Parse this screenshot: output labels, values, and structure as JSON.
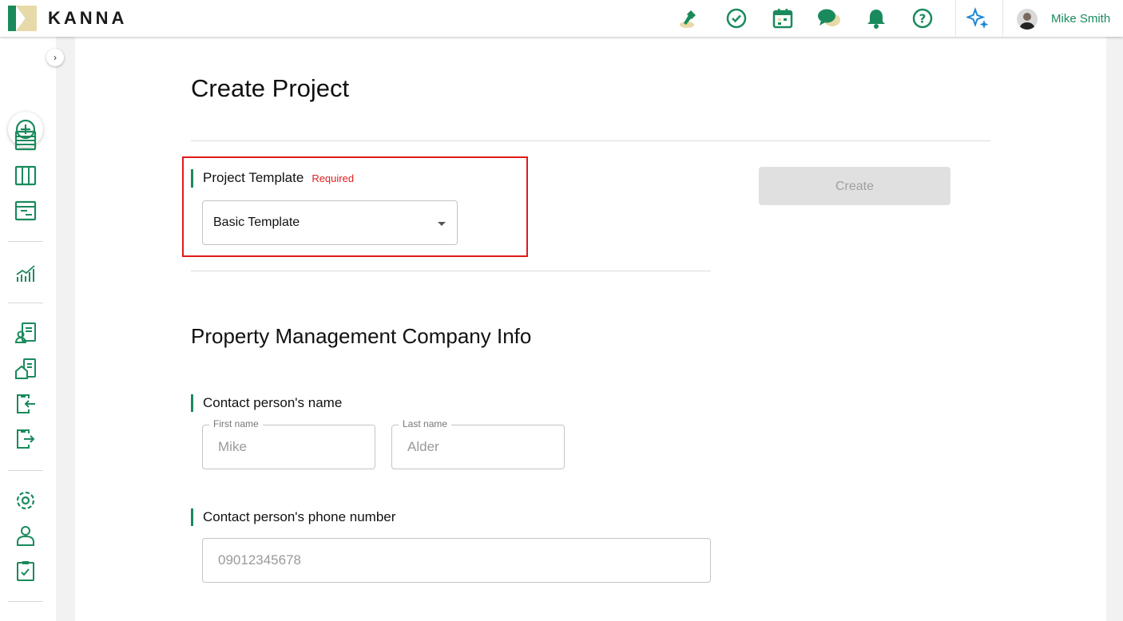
{
  "header": {
    "logo_text": "KANNA",
    "user_name": "Mike Smith",
    "icons": [
      "stamp-icon",
      "check-circle-icon",
      "calendar-icon",
      "chat-icon",
      "bell-icon",
      "help-icon",
      "sparkle-icon"
    ]
  },
  "sidebar": {
    "collapse_glyph": "›",
    "icons": [
      "add-icon",
      "list-icon",
      "board-icon",
      "gantt-icon",
      "analytics-icon",
      "client-icon",
      "property-icon",
      "import-icon",
      "export-icon",
      "settings-icon",
      "user-icon",
      "checklist-icon"
    ]
  },
  "page": {
    "title": "Create Project",
    "create_label": "Create",
    "template": {
      "label": "Project Template",
      "required": "Required",
      "selected": "Basic Template"
    },
    "section_title": "Property Management Company Info",
    "contact_name": {
      "label": "Contact person's name",
      "first_label": "First name",
      "first_placeholder": "Mike",
      "last_label": "Last name",
      "last_placeholder": "Alder"
    },
    "contact_phone": {
      "label": "Contact person's phone number",
      "placeholder": "09012345678"
    }
  },
  "colors": {
    "accent": "#1a8a5c",
    "highlight": "#e01a1a",
    "required": "#e02020"
  }
}
